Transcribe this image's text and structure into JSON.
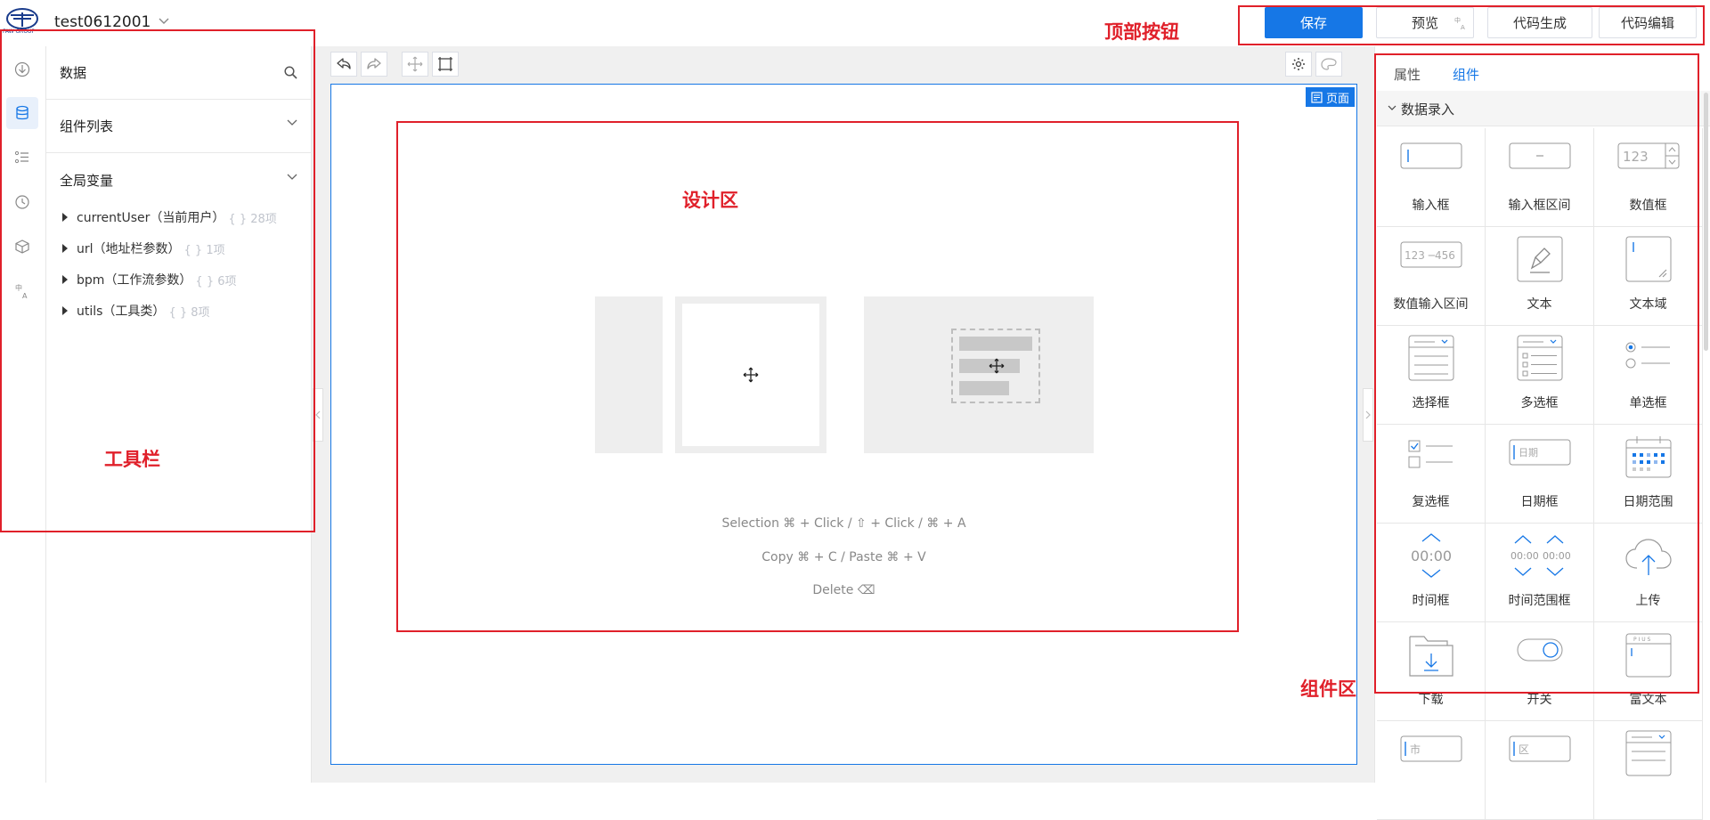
{
  "header": {
    "logo_text": "FAW GROUP",
    "project_name": "test0612001",
    "buttons": {
      "save": "保存",
      "preview": "预览",
      "codegen": "代码生成",
      "codeedit": "代码编辑"
    }
  },
  "rail": {
    "icons": [
      "download-icon",
      "database-icon",
      "list-settings-icon",
      "history-icon",
      "cube-icon",
      "translate-icon"
    ],
    "active_index": 1
  },
  "left_panel": {
    "data_title": "数据",
    "components_title": "组件列表",
    "globals_title": "全局变量",
    "variables": [
      {
        "name": "currentUser（当前用户）",
        "count": "{ } 28项"
      },
      {
        "name": "url（地址栏参数）",
        "count": "{ } 1项"
      },
      {
        "name": "bpm（工作流参数）",
        "count": "{ } 6项"
      },
      {
        "name": "utils（工具类）",
        "count": "{ } 8项"
      }
    ]
  },
  "canvas": {
    "page_badge": "页面",
    "hint_selection": "Selection ⌘ + Click / ⇧ + Click / ⌘ + A",
    "hint_copy": "Copy ⌘ + C / Paste ⌘ + V",
    "hint_delete": "Delete ⌫"
  },
  "right_panel": {
    "tabs": [
      "属性",
      "组件"
    ],
    "active_tab": 1,
    "group_title": "数据录入",
    "components": [
      {
        "label": "输入框",
        "icon": "input-icon"
      },
      {
        "label": "输入框区间",
        "icon": "input-range-icon"
      },
      {
        "label": "数值框",
        "icon": "number-input-icon"
      },
      {
        "label": "数值输入区间",
        "icon": "number-range-icon"
      },
      {
        "label": "文本",
        "icon": "text-icon"
      },
      {
        "label": "文本域",
        "icon": "textarea-icon"
      },
      {
        "label": "选择框",
        "icon": "select-icon"
      },
      {
        "label": "多选框",
        "icon": "multi-select-icon"
      },
      {
        "label": "单选框",
        "icon": "radio-icon"
      },
      {
        "label": "复选框",
        "icon": "checkbox-icon"
      },
      {
        "label": "日期框",
        "icon": "date-input-icon"
      },
      {
        "label": "日期范围",
        "icon": "date-range-icon"
      },
      {
        "label": "时间框",
        "icon": "time-input-icon"
      },
      {
        "label": "时间范围框",
        "icon": "time-range-icon"
      },
      {
        "label": "上传",
        "icon": "upload-icon"
      },
      {
        "label": "下载",
        "icon": "download-folder-icon"
      },
      {
        "label": "开关",
        "icon": "switch-icon"
      },
      {
        "label": "富文本",
        "icon": "rich-text-icon"
      },
      {
        "label": "",
        "icon": "city-select-icon"
      },
      {
        "label": "",
        "icon": "district-select-icon"
      },
      {
        "label": "",
        "icon": "list-select-icon"
      }
    ],
    "cell_texts": {
      "number": "123",
      "number_range": "123 ─456",
      "date": "日期",
      "time": "00:00",
      "city": "市",
      "district": "区",
      "plus": "P I U S"
    }
  },
  "annotations": {
    "top_buttons": "顶部按钮",
    "design_area": "设计区",
    "toolbar": "工具栏",
    "component_area": "组件区"
  },
  "colors": {
    "primary": "#1677e6",
    "annotation": "#e0202a"
  }
}
